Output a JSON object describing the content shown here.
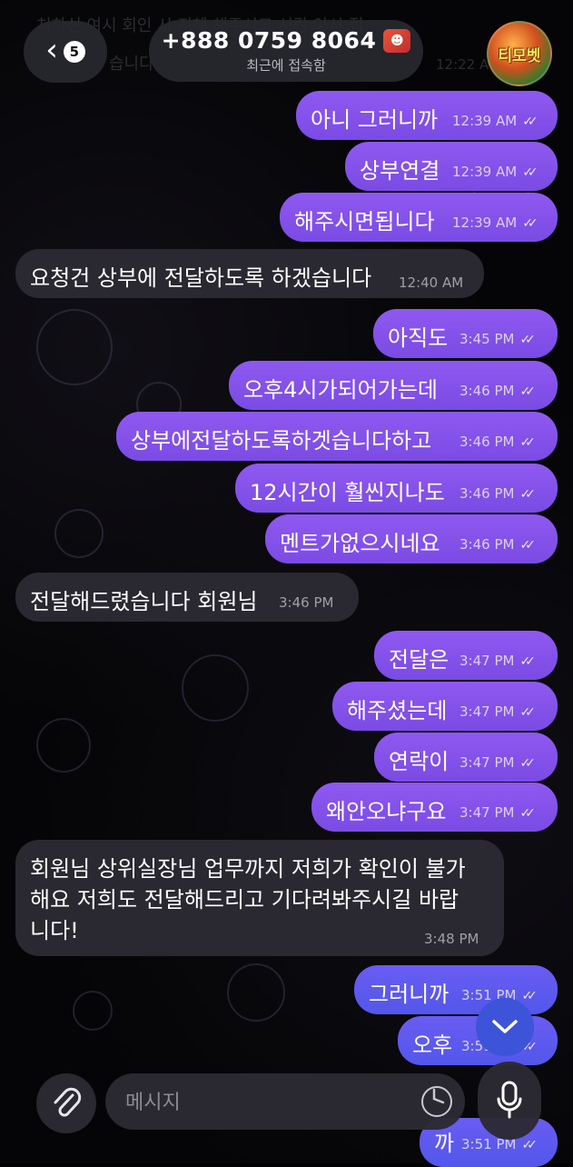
{
  "header": {
    "back_count": "5",
    "contact_name": "+888 0759 8064",
    "status": "최근에 접속함",
    "avatar_text": "티모벳"
  },
  "behind_text": {
    "line1": "처하신 여시 회인 시 지혜 채주시고 서란 아시 점",
    "line2": "습니다",
    "time": "12:22 AM"
  },
  "messages": [
    {
      "text": "아니 그러니까",
      "time": "12:39 AM",
      "dir": "out"
    },
    {
      "text": "상부연결",
      "time": "12:39 AM",
      "dir": "out"
    },
    {
      "text": "해주시면됩니다",
      "time": "12:39 AM",
      "dir": "out"
    },
    {
      "text": "요청건 상부에 전달하도록 하겠습니다",
      "time": "12:40 AM",
      "dir": "in"
    },
    {
      "text": "아직도",
      "time": "3:45 PM",
      "dir": "out"
    },
    {
      "text": "오후4시가되어가는데",
      "time": "3:46 PM",
      "dir": "out"
    },
    {
      "text": "상부에전달하도록하겟습니다하고",
      "time": "3:46 PM",
      "dir": "out"
    },
    {
      "text": "12시간이 훨씬지나도",
      "time": "3:46 PM",
      "dir": "out"
    },
    {
      "text": "멘트가없으시네요",
      "time": "3:46 PM",
      "dir": "out"
    },
    {
      "text": "전달해드렸습니다 회원님",
      "time": "3:46 PM",
      "dir": "in"
    },
    {
      "text": "전달은",
      "time": "3:47 PM",
      "dir": "out"
    },
    {
      "text": "해주셨는데",
      "time": "3:47 PM",
      "dir": "out"
    },
    {
      "text": "연락이",
      "time": "3:47 PM",
      "dir": "out"
    },
    {
      "text": "왜안오냐구요",
      "time": "3:47 PM",
      "dir": "out"
    },
    {
      "text_lines": [
        "회원님 상위실장님 업무까지 저희가 확인이 불가",
        "해요 저희도 전달해드리고 기다려봐주시길 바랍",
        "니다!"
      ],
      "time": "3:48 PM",
      "dir": "in"
    },
    {
      "text": "그러니까",
      "time": "3:51 PM",
      "dir": "out"
    },
    {
      "text": "오후",
      "time": "3:51 PM",
      "dir": "out"
    },
    {
      "text": "까",
      "time": "3:51 PM",
      "dir": "out"
    }
  ],
  "composer": {
    "placeholder": "메시지"
  },
  "icons": {
    "back": "chevron-left-icon",
    "attach": "paperclip-icon",
    "sticker": "sticker-icon",
    "mic": "microphone-icon",
    "scroll": "chevron-down-icon",
    "read": "double-check-icon"
  },
  "colors": {
    "outgoing_bubble": "#8259ed",
    "outgoing_bubble_bottom": "#5a57ea",
    "incoming_bubble": "#2c2a32",
    "scroll_button": "#3d54d8",
    "background": "#050507"
  }
}
